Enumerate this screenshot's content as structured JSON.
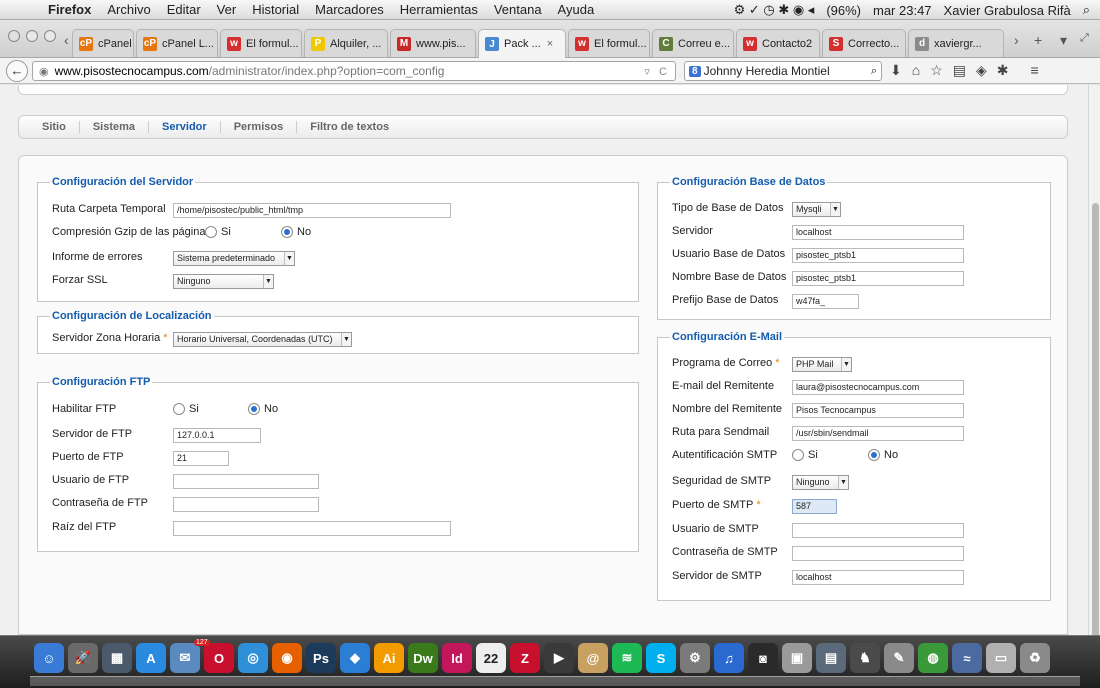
{
  "menubar": {
    "app": "Firefox",
    "items": [
      "Archivo",
      "Editar",
      "Ver",
      "Historial",
      "Marcadores",
      "Herramientas",
      "Ventana",
      "Ayuda"
    ],
    "battery": "(96%)",
    "clock": "mar 23:47",
    "user": "Xavier Grabulosa Rifà"
  },
  "tabs": [
    {
      "label": "cPanel L...",
      "icon": "cP",
      "color": "#e8750e"
    },
    {
      "label": "cPanel L...",
      "icon": "cP",
      "color": "#e8750e"
    },
    {
      "label": "El formul...",
      "icon": "w",
      "color": "#d32f2f"
    },
    {
      "label": "Alquiler, ...",
      "icon": "P",
      "color": "#f0c800"
    },
    {
      "label": "www.pis...",
      "icon": "M",
      "color": "#c62828"
    },
    {
      "label": "Pack ...",
      "icon": "J",
      "color": "#4a8ad0"
    },
    {
      "label": "El formul...",
      "icon": "w",
      "color": "#d32f2f"
    },
    {
      "label": "Correu e...",
      "icon": "C",
      "color": "#607d3b"
    },
    {
      "label": "Contacto2",
      "icon": "w",
      "color": "#d32f2f"
    },
    {
      "label": "Correcto...",
      "icon": "S",
      "color": "#d32f2f"
    },
    {
      "label": "xaviergr...",
      "icon": "d",
      "color": "#8a8a8a"
    }
  ],
  "url": {
    "host": "www.pisostecnocampus.com",
    "path": "/administrator/index.php?option=com_config"
  },
  "search": {
    "engine": "8",
    "value": "Johnny Heredia Montiel"
  },
  "subtabs": [
    "Sitio",
    "Sistema",
    "Servidor",
    "Permisos",
    "Filtro de textos"
  ],
  "server": {
    "legend": "Configuración del Servidor",
    "temp_label": "Ruta Carpeta Temporal",
    "temp_value": "/home/pisostec/public_html/tmp",
    "gzip_label": "Compresión Gzip de las páginas",
    "si": "Si",
    "no": "No",
    "errors_label": "Informe de errores",
    "errors_value": "Sistema predeterminado",
    "ssl_label": "Forzar SSL",
    "ssl_value": "Ninguno"
  },
  "locale": {
    "legend": "Configuración de Localización",
    "tz_label": "Servidor Zona Horaria",
    "tz_value": "Horario Universal, Coordenadas (UTC)"
  },
  "ftp": {
    "legend": "Configuración FTP",
    "enable_label": "Habilitar FTP",
    "si": "Si",
    "no": "No",
    "host_label": "Servidor de FTP",
    "host_value": "127.0.0.1",
    "port_label": "Puerto de FTP",
    "port_value": "21",
    "user_label": "Usuario de FTP",
    "pass_label": "Contraseña de FTP",
    "root_label": "Raíz del FTP"
  },
  "db": {
    "legend": "Configuración Base de Datos",
    "type_label": "Tipo de Base de Datos",
    "type_value": "Mysqli",
    "host_label": "Servidor",
    "host_value": "localhost",
    "user_label": "Usuario Base de Datos",
    "user_value": "pisostec_ptsb1",
    "name_label": "Nombre Base de Datos",
    "name_value": "pisostec_ptsb1",
    "prefix_label": "Prefijo Base de Datos",
    "prefix_value": "w47fa_"
  },
  "mail": {
    "legend": "Configuración E-Mail",
    "mailer_label": "Programa de Correo",
    "mailer_value": "PHP Mail",
    "from_label": "E-mail del Remitente",
    "from_value": "laura@pisostecnocampus.com",
    "fromname_label": "Nombre del Remitente",
    "fromname_value": "Pisos Tecnocampus",
    "sendmail_label": "Ruta para Sendmail",
    "sendmail_value": "/usr/sbin/sendmail",
    "auth_label": "Autentificación SMTP",
    "si": "Si",
    "no": "No",
    "secure_label": "Seguridad de SMTP",
    "secure_value": "Ninguno",
    "port_label": "Puerto de SMTP",
    "port_value": "587",
    "user_label": "Usuario de SMTP",
    "pass_label": "Contraseña de SMTP",
    "host_label": "Servidor de SMTP",
    "host_value": "localhost"
  },
  "dock": [
    {
      "name": "finder",
      "t": "☺",
      "c": "#3a7bd5"
    },
    {
      "name": "launchpad",
      "t": "🚀",
      "c": "#6a6a6a"
    },
    {
      "name": "mission-control",
      "t": "▦",
      "c": "#4a5a6a"
    },
    {
      "name": "app-store",
      "t": "A",
      "c": "#2a8ae0"
    },
    {
      "name": "mail",
      "t": "✉",
      "c": "#5a8ac0"
    },
    {
      "name": "opera",
      "t": "O",
      "c": "#c8102e"
    },
    {
      "name": "safari",
      "t": "◎",
      "c": "#2f8fd8"
    },
    {
      "name": "firefox",
      "t": "◉",
      "c": "#e66000"
    },
    {
      "name": "photoshop",
      "t": "Ps",
      "c": "#1c3a5a"
    },
    {
      "name": "dropbox",
      "t": "◆",
      "c": "#2a7fd4"
    },
    {
      "name": "illustrator",
      "t": "Ai",
      "c": "#f29b00"
    },
    {
      "name": "dreamweaver",
      "t": "Dw",
      "c": "#3a7a1a"
    },
    {
      "name": "indesign",
      "t": "Id",
      "c": "#c2185b"
    },
    {
      "name": "calendar",
      "t": "22",
      "c": "#eeeeee"
    },
    {
      "name": "filezilla",
      "t": "Z",
      "c": "#c8102e"
    },
    {
      "name": "facetime",
      "t": "▶",
      "c": "#3a3a3a"
    },
    {
      "name": "contacts",
      "t": "@",
      "c": "#c8a060"
    },
    {
      "name": "spotify",
      "t": "≋",
      "c": "#1db954"
    },
    {
      "name": "skype",
      "t": "S",
      "c": "#00aff0"
    },
    {
      "name": "preferences",
      "t": "⚙",
      "c": "#7a7a7a"
    },
    {
      "name": "itunes",
      "t": "♫",
      "c": "#2a6ad0"
    },
    {
      "name": "photo-booth",
      "t": "◙",
      "c": "#2a2a2a"
    },
    {
      "name": "preview",
      "t": "▣",
      "c": "#9a9a9a"
    },
    {
      "name": "network",
      "t": "▤",
      "c": "#5a6a7a"
    },
    {
      "name": "chess",
      "t": "♞",
      "c": "#4a4a4a"
    },
    {
      "name": "script-editor",
      "t": "✎",
      "c": "#8a8a8a"
    },
    {
      "name": "chrome",
      "t": "◍",
      "c": "#3a9a3a"
    },
    {
      "name": "network-monitor",
      "t": "≈",
      "c": "#4a6aa0"
    },
    {
      "name": "downloads",
      "t": "▭",
      "c": "#b0b0b0"
    },
    {
      "name": "trash",
      "t": "♻",
      "c": "#8a8a8a"
    }
  ],
  "dock_badge": "127"
}
